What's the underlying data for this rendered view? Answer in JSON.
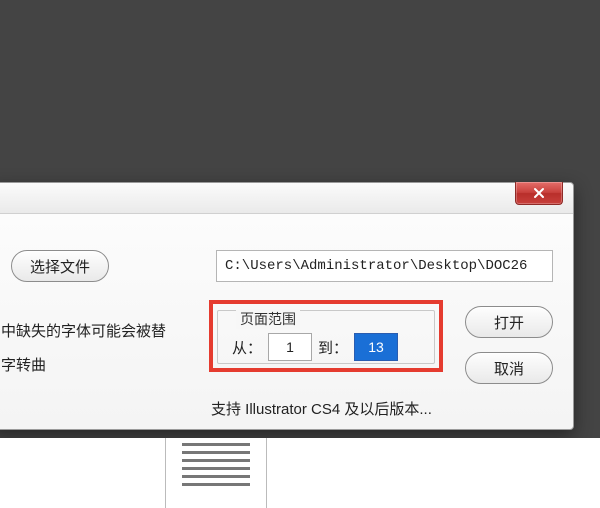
{
  "dialog": {
    "choose_file_label": "选择文件",
    "file_path": "C:\\Users\\Administrator\\Desktop\\DOC26",
    "hint_missing_font": "中缺失的字体可能会被替",
    "hint_outline": "字转曲",
    "range": {
      "legend": "页面范围",
      "from_label": "从：",
      "from_value": "1",
      "to_label": "到：",
      "to_value": "13"
    },
    "open_label": "打开",
    "cancel_label": "取消",
    "support_label": "支持 Illustrator CS4 及以后版本..."
  }
}
